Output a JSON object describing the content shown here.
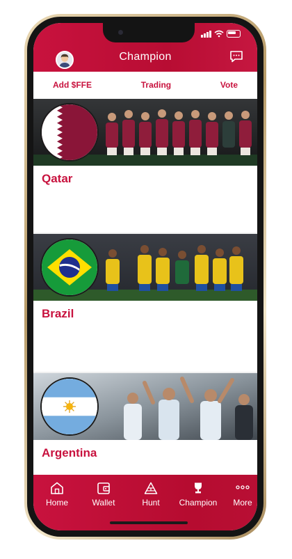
{
  "header": {
    "title": "Champion",
    "avatar_icon": "user-avatar-icon",
    "chat_icon": "chat-bubble-icon"
  },
  "tabs": [
    {
      "label": "Add $FFE"
    },
    {
      "label": "Trading"
    },
    {
      "label": "Vote"
    }
  ],
  "teams": [
    {
      "name": "Qatar",
      "flag": "qatar-flag-icon"
    },
    {
      "name": "Brazil",
      "flag": "brazil-flag-icon"
    },
    {
      "name": "Argentina",
      "flag": "argentina-flag-icon"
    }
  ],
  "nav": [
    {
      "label": "Home",
      "icon": "home-icon"
    },
    {
      "label": "Wallet",
      "icon": "wallet-icon"
    },
    {
      "label": "Hunt",
      "icon": "pyramid-icon"
    },
    {
      "label": "Champion",
      "icon": "trophy-icon"
    },
    {
      "label": "More",
      "icon": "more-icon"
    }
  ],
  "colors": {
    "brand": "#c8123e",
    "brand_dark": "#b60c30",
    "text_on_brand": "#ffffff"
  }
}
